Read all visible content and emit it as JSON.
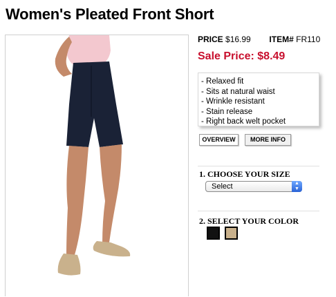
{
  "product": {
    "title": "Women's Pleated Front Short",
    "price_label": "PRICE",
    "price": "$16.99",
    "item_label": "ITEM#",
    "item_number": "FR110",
    "sale_price": "Sale Price: $8.49"
  },
  "features": [
    "- Relaxed fit",
    "- Sits at natural waist",
    "- Wrinkle resistant",
    "- Stain release",
    "- Right back welt pocket"
  ],
  "tabs": {
    "overview": "OVERVIEW",
    "more_info": "MORE INFO"
  },
  "size": {
    "label": "1. CHOOSE YOUR SIZE",
    "selected": "Select"
  },
  "color": {
    "label": "2. SELECT YOUR COLOR",
    "swatches": [
      {
        "name": "navy-black",
        "hex": "#111111"
      },
      {
        "name": "khaki",
        "hex": "#c9b18c"
      }
    ]
  },
  "colors": {
    "sale": "#c8102e",
    "shorts": "#1a2236",
    "shirt": "#f3c8cf",
    "skin": "#c48a6a"
  }
}
